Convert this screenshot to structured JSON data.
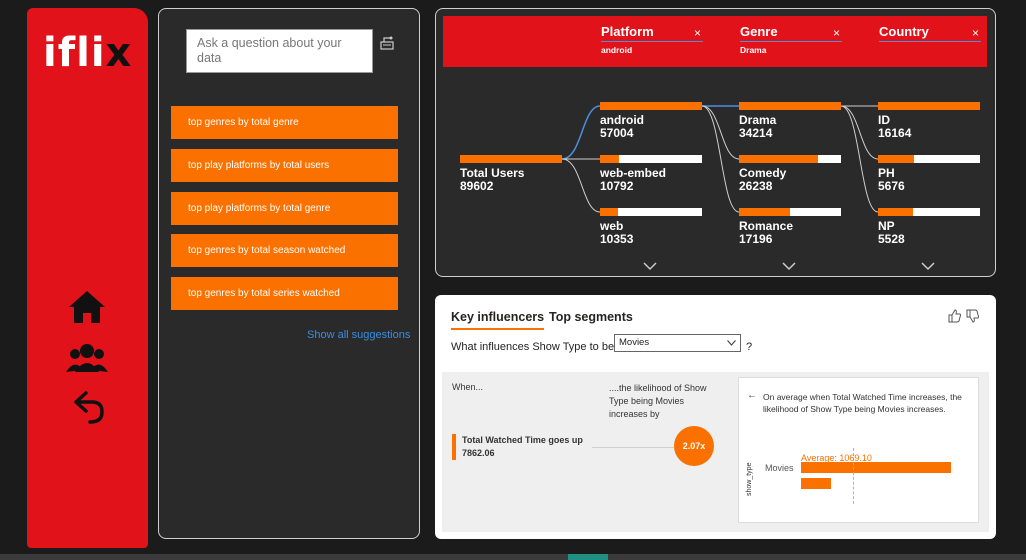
{
  "logo": {
    "text_main": "ifli",
    "text_end": "x"
  },
  "nav": {
    "icons": [
      "home-icon",
      "users-group-icon",
      "back-arrow-icon"
    ]
  },
  "qna": {
    "placeholder": "Ask a question about your data",
    "suggestions": [
      "top genres by total genre",
      "top play platforms by total users",
      "top play platforms by total genre",
      "top genres by total season watched",
      "top genres by total series watched"
    ],
    "show_all": "Show all suggestions"
  },
  "decomp": {
    "header": [
      {
        "label": "Platform",
        "selected": "android"
      },
      {
        "label": "Genre",
        "selected": "Drama"
      },
      {
        "label": "Country",
        "selected": ""
      }
    ],
    "close_glyph": "×",
    "root": {
      "name": "Total Users",
      "value": "89602",
      "fill": 1.0
    },
    "levels": [
      [
        {
          "name": "android",
          "value": "57004",
          "fill": 1.0
        },
        {
          "name": "web-embed",
          "value": "10792",
          "fill": 0.19
        },
        {
          "name": "web",
          "value": "10353",
          "fill": 0.18
        }
      ],
      [
        {
          "name": "Drama",
          "value": "34214",
          "fill": 1.0
        },
        {
          "name": "Comedy",
          "value": "26238",
          "fill": 0.77
        },
        {
          "name": "Romance",
          "value": "17196",
          "fill": 0.5
        }
      ],
      [
        {
          "name": "ID",
          "value": "16164",
          "fill": 1.0
        },
        {
          "name": "PH",
          "value": "5676",
          "fill": 0.35
        },
        {
          "name": "NP",
          "value": "5528",
          "fill": 0.34
        }
      ]
    ]
  },
  "ki": {
    "tab_active": "Key influencers",
    "tab_other": "Top segments",
    "question": "What influences Show Type to be",
    "dropdown_value": "Movies",
    "question_mark": "?",
    "when": "When...",
    "likelihood": "....the likelihood of Show Type being Movies increases by",
    "influencer": "Total Watched Time goes up 7862.06",
    "multiplier": "2.07x",
    "detail_text": "On average when Total Watched Time increases, the likelihood of Show Type being Movies increases.",
    "detail_back_glyph": "←",
    "axis_label": "show_type",
    "category": "Movies",
    "average_label": "Average: 1069.10"
  },
  "colors": {
    "brand_red": "#e2121b",
    "accent_orange": "#fb7100",
    "link_blue": "#3a8dde"
  }
}
